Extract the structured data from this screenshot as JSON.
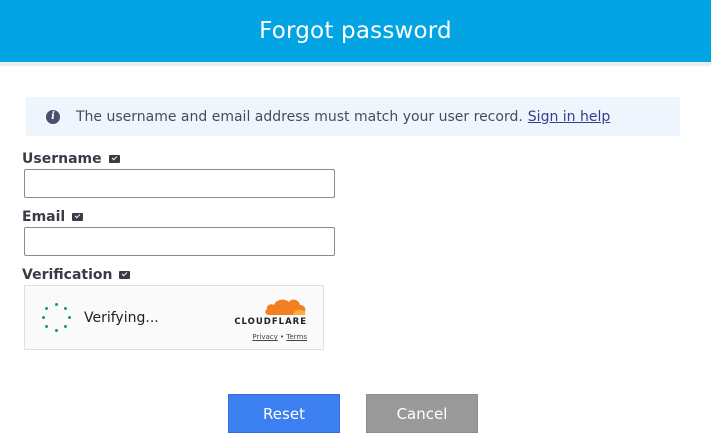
{
  "header": {
    "title": "Forgot password"
  },
  "info": {
    "message": "The username and email address must match your user record.",
    "link_label": "Sign in help"
  },
  "form": {
    "username_label": "Username",
    "username_value": "",
    "email_label": "Email",
    "email_value": "",
    "verification_label": "Verification"
  },
  "captcha": {
    "status_text": "Verifying...",
    "brand": "CLOUDFLARE",
    "privacy_label": "Privacy",
    "separator": "•",
    "terms_label": "Terms"
  },
  "buttons": {
    "reset_label": "Reset",
    "cancel_label": "Cancel"
  },
  "colors": {
    "header_bg": "#02a4e4",
    "reset_bg": "#3b7ff1",
    "cancel_bg": "#9a9a9a",
    "spinner": "#1a9e55",
    "cloudflare_orange": "#f38020"
  },
  "icons": {
    "info": "info-icon",
    "required": "check-badge-icon",
    "cloud": "cloudflare-cloud-icon"
  }
}
